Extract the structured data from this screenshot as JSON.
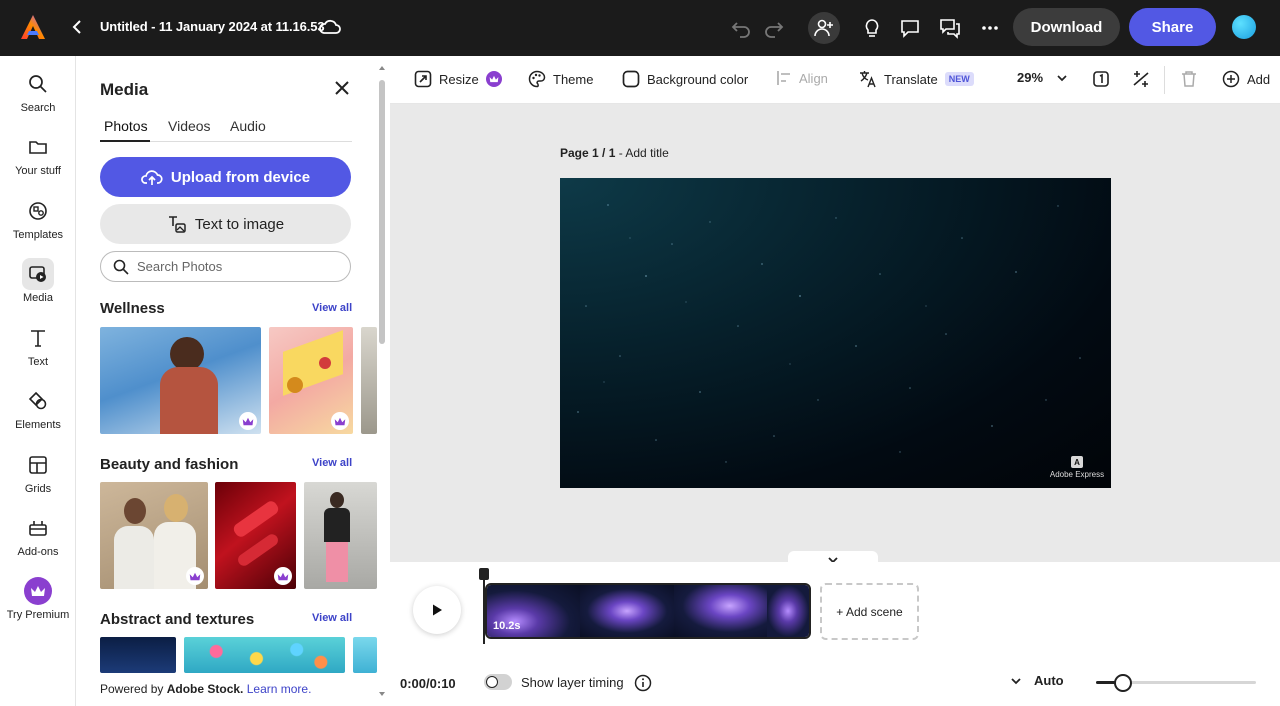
{
  "topbar": {
    "doc_title": "Untitled - 11 January 2024 at 11.16.53",
    "download_label": "Download",
    "share_label": "Share"
  },
  "rail": {
    "items": [
      {
        "label": "Search",
        "icon": "search-icon"
      },
      {
        "label": "Your stuff",
        "icon": "folder-icon"
      },
      {
        "label": "Templates",
        "icon": "templates-icon"
      },
      {
        "label": "Media",
        "icon": "media-icon"
      },
      {
        "label": "Text",
        "icon": "text-icon"
      },
      {
        "label": "Elements",
        "icon": "elements-icon"
      },
      {
        "label": "Grids",
        "icon": "grids-icon"
      },
      {
        "label": "Add-ons",
        "icon": "addons-icon"
      },
      {
        "label": "Try Premium",
        "icon": "crown-icon"
      }
    ],
    "active": "Media"
  },
  "panel": {
    "title": "Media",
    "tabs": [
      "Photos",
      "Videos",
      "Audio"
    ],
    "active_tab": "Photos",
    "upload_label": "Upload from device",
    "text_to_image_label": "Text to image",
    "search_placeholder": "Search Photos",
    "sections": [
      {
        "title": "Wellness",
        "view_all": "View all"
      },
      {
        "title": "Beauty and fashion",
        "view_all": "View all"
      },
      {
        "title": "Abstract and textures",
        "view_all": "View all"
      }
    ],
    "footer_prefix": "Powered by ",
    "footer_brand": "Adobe Stock.",
    "footer_link": "Learn more."
  },
  "toolbar": {
    "resize": "Resize",
    "theme": "Theme",
    "background_color": "Background color",
    "align": "Align",
    "translate": "Translate",
    "new_badge": "NEW",
    "zoom": "29%",
    "add": "Add"
  },
  "canvas": {
    "page_label": "Page 1 / 1",
    "add_title": " - Add title",
    "watermark": "Adobe Express"
  },
  "timeline": {
    "scene_duration": "10.2s",
    "add_scene": "+ Add scene",
    "time": "0:00/0:10",
    "show_layer_timing": "Show layer timing",
    "auto": "Auto",
    "zoom_level": 0.17
  },
  "colors": {
    "accent": "#5258e4",
    "topbar": "#1b1b1b",
    "premium": "#8a3fcf"
  }
}
